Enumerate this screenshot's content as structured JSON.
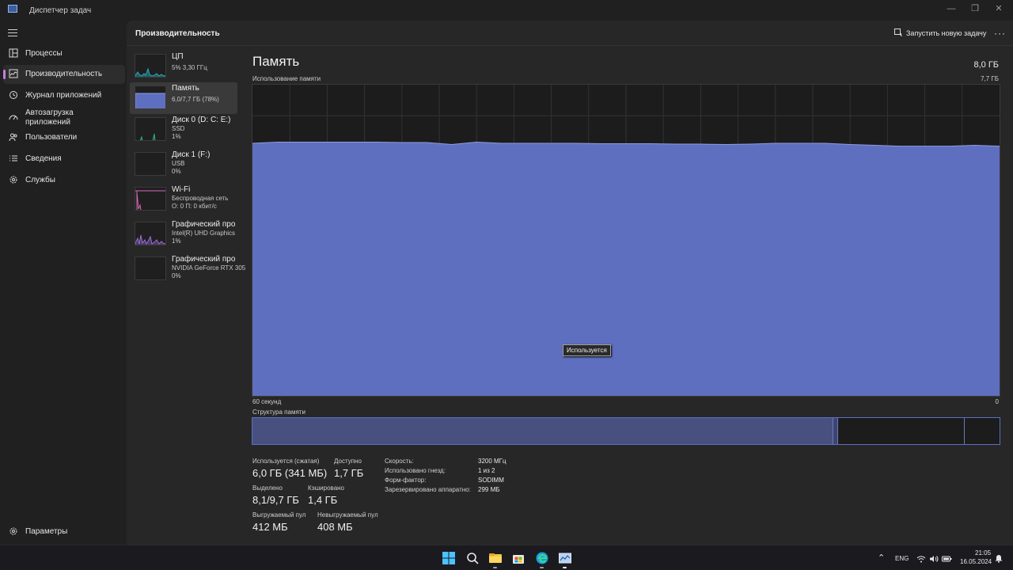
{
  "window": {
    "title": "Диспетчер задач",
    "minimize": "—",
    "restore": "❐",
    "close": "✕"
  },
  "nav": {
    "items": [
      {
        "label": "Процессы",
        "icon": "processes-icon"
      },
      {
        "label": "Производительность",
        "icon": "performance-icon"
      },
      {
        "label": "Журнал приложений",
        "icon": "app-history-icon"
      },
      {
        "label_line1": "Автозагрузка",
        "label_line2": "приложений",
        "icon": "startup-icon"
      },
      {
        "label": "Пользователи",
        "icon": "users-icon"
      },
      {
        "label": "Сведения",
        "icon": "details-icon"
      },
      {
        "label": "Службы",
        "icon": "services-icon"
      }
    ],
    "settings": {
      "label": "Параметры",
      "icon": "gear-icon"
    }
  },
  "header": {
    "title": "Производительность",
    "run_task": "Запустить новую задачу",
    "more": "···"
  },
  "resources": [
    {
      "name": "ЦП",
      "sub1": "5% 3,30 ГГц",
      "color": "#2ea6b8"
    },
    {
      "name": "Память",
      "sub1": "6,0/7,7 ГБ (78%)",
      "color": "#6a74c9"
    },
    {
      "name": "Диск 0 (D: C: E:)",
      "sub1": "SSD",
      "sub2": "1%",
      "color": "#3cab7e"
    },
    {
      "name": "Диск 1 (F:)",
      "sub1": "USB",
      "sub2": "0%",
      "color": "#3cab7e"
    },
    {
      "name": "Wi-Fi",
      "sub1": "Беспроводная сеть",
      "sub2": "О: 0 П: 0 кбит/с",
      "color": "#d668b8"
    },
    {
      "name": "Графический про",
      "sub1": "Intel(R) UHD Graphics",
      "sub2": "1%",
      "color": "#9a6fd0"
    },
    {
      "name": "Графический про",
      "sub1": "NVIDIA GeForce RTX 305",
      "sub2": "0%",
      "color": "#9a6fd0"
    }
  ],
  "memory": {
    "title": "Память",
    "total": "8,0 ГБ",
    "usage_label": "Использование памяти",
    "usage_max": "7,7 ГБ",
    "time_left": "60 секунд",
    "time_right": "0",
    "tooltip": "Используется",
    "structure_label": "Структура памяти",
    "fill_color": "#5f6fbf",
    "stats": {
      "in_use_label": "Используется (сжатая)",
      "in_use_value": "6,0 ГБ (341 МБ)",
      "available_label": "Доступно",
      "available_value": "1,7 ГБ",
      "committed_label": "Выделено",
      "committed_value": "8,1/9,7 ГБ",
      "cached_label": "Кэшировано",
      "cached_value": "1,4 ГБ",
      "paged_label": "Выгружаемый пул",
      "paged_value": "412 МБ",
      "nonpaged_label": "Невыгружаемый пул",
      "nonpaged_value": "408 МБ"
    },
    "details": [
      {
        "key": "Скорость:",
        "value": "3200 МГц"
      },
      {
        "key": "Использовано гнезд:",
        "value": "1 из 2"
      },
      {
        "key": "Форм-фактор:",
        "value": "SODIMM"
      },
      {
        "key": "Зарезервировано аппаратно:",
        "value": "299 МБ"
      }
    ]
  },
  "chart_data": {
    "type": "area",
    "title": "",
    "xlabel": "",
    "ylabel": "",
    "x": [
      60,
      58,
      56,
      54,
      52,
      50,
      48,
      46,
      44,
      42,
      40,
      38,
      36,
      34,
      32,
      30,
      28,
      26,
      24,
      22,
      20,
      18,
      16,
      14,
      12,
      10,
      8,
      6,
      4,
      2,
      0
    ],
    "series": [
      {
        "values": [
          6.25,
          6.28,
          6.28,
          6.28,
          6.28,
          6.28,
          6.27,
          6.27,
          6.22,
          6.28,
          6.25,
          6.25,
          6.25,
          6.25,
          6.24,
          6.24,
          6.24,
          6.23,
          6.23,
          6.22,
          6.23,
          6.25,
          6.25,
          6.25,
          6.22,
          6.2,
          6.18,
          6.18,
          6.18,
          6.2,
          6.18
        ]
      }
    ],
    "xlim": [
      60,
      0
    ],
    "ylim": [
      0,
      7.7
    ],
    "grid": true
  },
  "taskbar": {
    "lang": "ENG",
    "time": "21:05",
    "date": "16.05.2024",
    "chevron": "⌃"
  }
}
